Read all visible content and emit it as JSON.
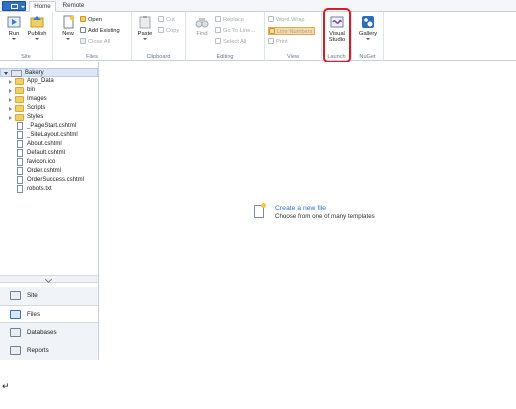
{
  "tabs": [
    {
      "label": "Home",
      "active": true
    },
    {
      "label": "Remote",
      "active": false
    }
  ],
  "ribbon": {
    "site": {
      "group_label": "Site",
      "run_label": "Run",
      "publish_label": "Publish"
    },
    "files": {
      "group_label": "Files",
      "new_label": "New",
      "open_label": "Open",
      "add_existing_label": "Add Existing",
      "close_all_label": "Close All"
    },
    "clipboard": {
      "group_label": "Clipboard",
      "paste_label": "Paste",
      "cut_label": "Cut",
      "copy_label": "Copy"
    },
    "editing": {
      "group_label": "Editing",
      "find_label": "Find",
      "replace_label": "Replace",
      "goto_label": "Go To Line...",
      "select_all_label": "Select All"
    },
    "view": {
      "group_label": "View",
      "word_wrap_label": "Word Wrap",
      "line_numbers_label": "Line Numbers",
      "print_label": "Print"
    },
    "launch": {
      "group_label": "Launch",
      "visual_studio_label_1": "Visual",
      "visual_studio_label_2": "Studio"
    },
    "nuget": {
      "group_label": "NuGet",
      "gallery_label": "Gallery"
    }
  },
  "tree": {
    "root": "Bakery",
    "folders": [
      "App_Data",
      "bin",
      "Images",
      "Scripts",
      "Styles"
    ],
    "files": [
      "_PageStart.cshtml",
      "_SiteLayout.cshtml",
      "About.cshtml",
      "Default.cshtml",
      "favicon.ico",
      "Order.cshtml",
      "OrderSuccess.cshtml",
      "robots.txt"
    ]
  },
  "nav": [
    {
      "label": "Site",
      "icon": "site-icon",
      "active": false
    },
    {
      "label": "Files",
      "icon": "files-icon",
      "active": true
    },
    {
      "label": "Databases",
      "icon": "databases-icon",
      "active": false
    },
    {
      "label": "Reports",
      "icon": "reports-icon",
      "active": false
    }
  ],
  "main": {
    "create_link": "Create a new file",
    "create_sub": "Choose from one of many templates"
  },
  "colors": {
    "accent": "#2f6fc6",
    "highlight_ring": "#d21d2a",
    "line_numbers_highlight": "#f7d8a3"
  },
  "trailing_mark": "↵"
}
